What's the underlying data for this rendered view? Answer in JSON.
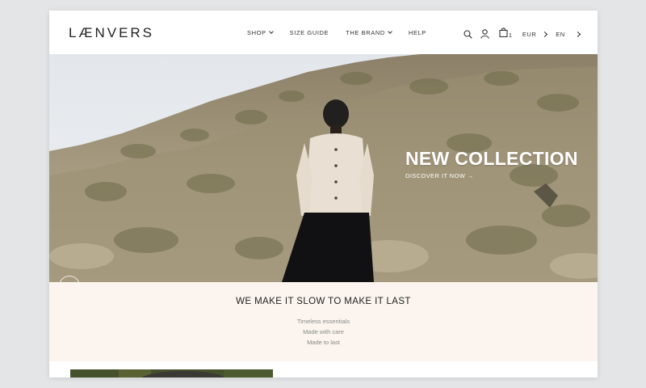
{
  "header": {
    "logo": "LÆNVERS",
    "nav": [
      {
        "label": "SHOP",
        "dropdown": true
      },
      {
        "label": "SIZE GUIDE",
        "dropdown": false
      },
      {
        "label": "THE BRAND",
        "dropdown": true
      },
      {
        "label": "HELP",
        "dropdown": false
      }
    ],
    "icons": [
      "search-icon",
      "account-icon",
      "cart-icon"
    ],
    "cart_count": "1",
    "currency": "EUR",
    "language": "EN"
  },
  "hero": {
    "title": "NEW COLLECTION",
    "link": "DISCOVER IT NOW →"
  },
  "tagline": {
    "heading": "WE MAKE IT SLOW TO MAKE IT LAST",
    "lines": [
      "Timeless essentials",
      "Made with care",
      "Made to last"
    ]
  },
  "colors": {
    "tagline_bg": "#fcf5ef",
    "page_bg": "#e4e5e7",
    "text": "#222222"
  }
}
